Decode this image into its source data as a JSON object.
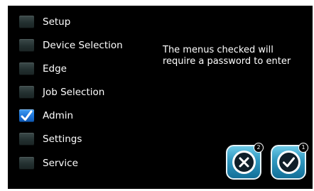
{
  "menu": {
    "items": [
      {
        "label": "Setup",
        "checked": false
      },
      {
        "label": "Device Selection",
        "checked": false
      },
      {
        "label": "Edge",
        "checked": false
      },
      {
        "label": "Job Selection",
        "checked": false
      },
      {
        "label": "Admin",
        "checked": true
      },
      {
        "label": "Settings",
        "checked": false
      },
      {
        "label": "Service",
        "checked": false
      }
    ]
  },
  "info": {
    "line1": "The menus checked will",
    "line2": "require a password to enter"
  },
  "buttons": {
    "cancel": {
      "icon": "close-icon",
      "badge": "2"
    },
    "confirm": {
      "icon": "check-icon",
      "badge": "1"
    }
  },
  "colors": {
    "background": "#000000",
    "checkbox_checked": "#1c73d8",
    "button_accent": "#2f97bf"
  }
}
